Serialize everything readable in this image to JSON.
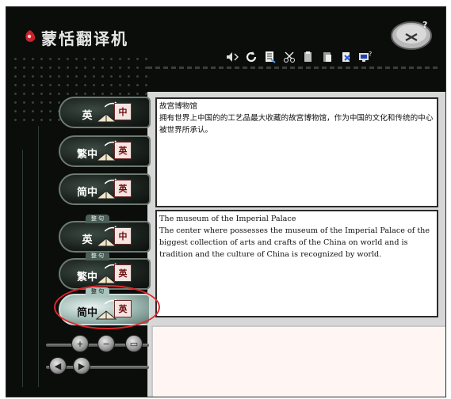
{
  "app": {
    "title": "蒙恬翻译机"
  },
  "toolbar": {
    "icons": [
      "speaker-icon",
      "refresh-icon",
      "document-list-icon",
      "scissors-icon",
      "copy-icon",
      "paste-icon",
      "close-doc-icon",
      "help-computer-icon"
    ]
  },
  "modes": {
    "word": [
      {
        "label": "英",
        "card": "中"
      },
      {
        "label": "繁中",
        "card": "英"
      },
      {
        "label": "简中",
        "card": "英"
      }
    ],
    "sentence": [
      {
        "tag": "整 句",
        "label": "英",
        "card": "中"
      },
      {
        "tag": "整 句",
        "label": "繁中",
        "card": "英"
      },
      {
        "tag": "整 句",
        "label": "简中",
        "card": "英",
        "active": true
      }
    ]
  },
  "source": {
    "line1": "故宫博物馆",
    "line2": "拥有世界上中国的的工艺品最大收藏的故宫博物馆，作为中国的文化和传统的中心被世界所承认。"
  },
  "translation": {
    "line1": "The museum of the Imperial Palace",
    "line2": "The center where possesses the museum of the Imperial Palace of the biggest collection of arts and crafts of the China on world and is tradition and the culture of China is recognized by world."
  },
  "colors": {
    "highlight": "#e0262b",
    "panel_bg": "#ffffff",
    "app_bg": "#0b0d0b"
  }
}
